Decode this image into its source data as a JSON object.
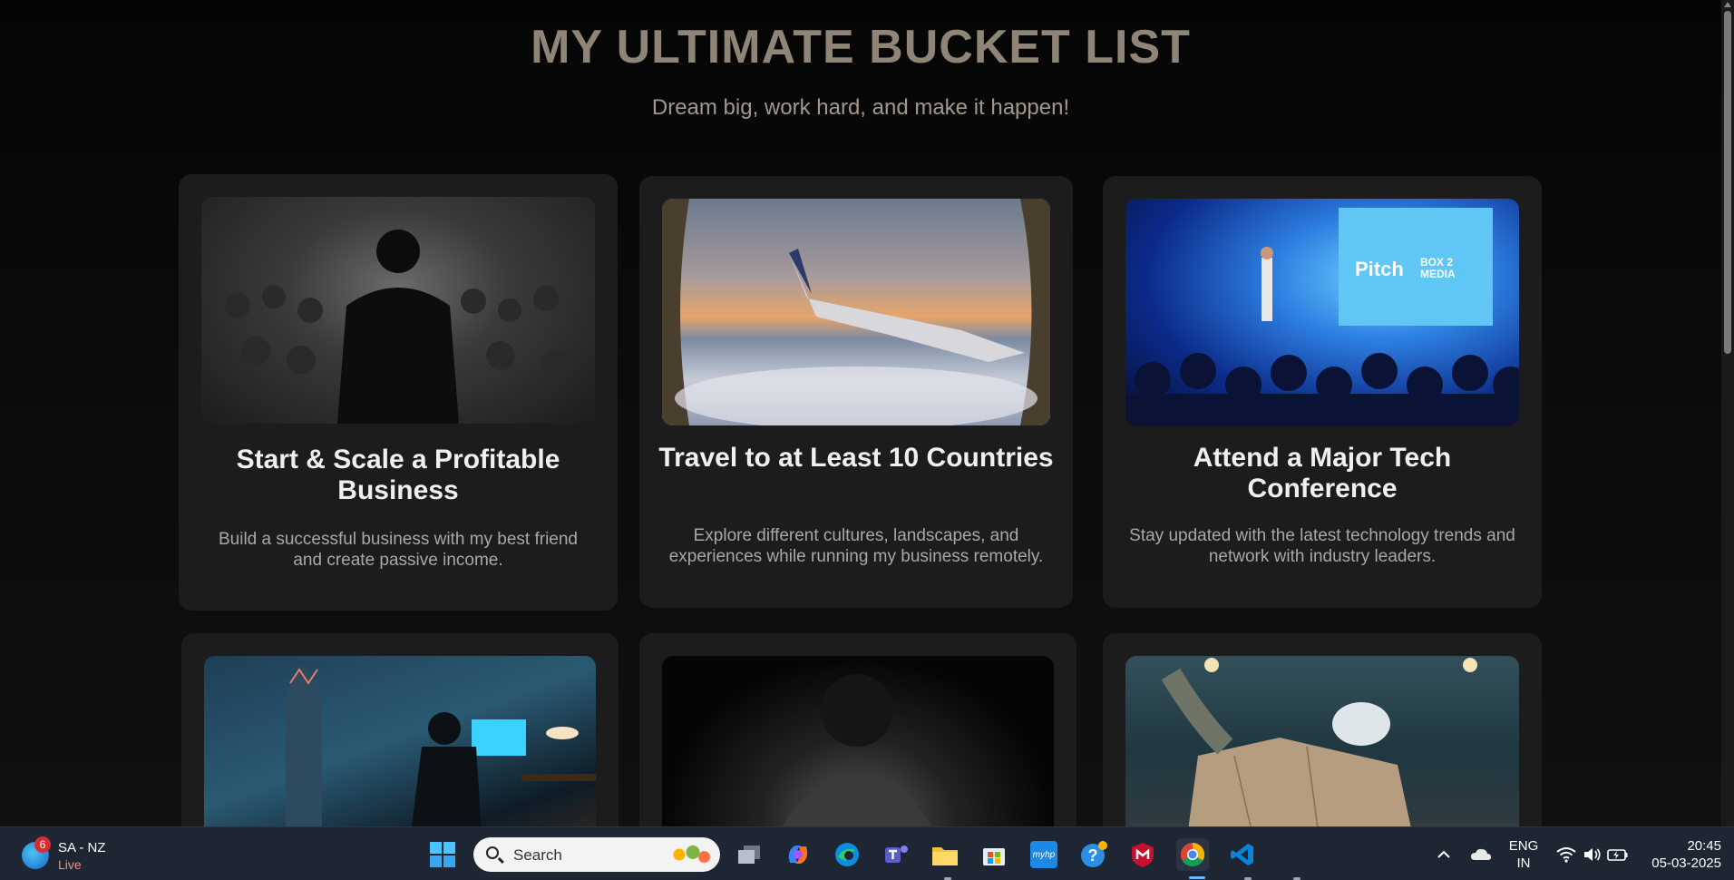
{
  "header": {
    "title": "MY ULTIMATE BUCKET LIST",
    "subtitle": "Dream big, work hard, and make it happen!"
  },
  "cards": [
    {
      "title": "Start & Scale a Profitable Business",
      "desc": "Build a successful business with my best friend and create passive income."
    },
    {
      "title": "Travel to at Least 10 Countries",
      "desc": "Explore different cultures, landscapes, and experiences while running my business remotely."
    },
    {
      "title": "Attend a Major Tech Conference",
      "desc": "Stay updated with the latest technology trends and network with industry leaders."
    },
    {
      "title": "",
      "desc": ""
    },
    {
      "title": "",
      "desc": ""
    },
    {
      "title": "",
      "desc": ""
    }
  ],
  "tech_screen": {
    "brand1": "Pitch",
    "brand2": "BOX 2\nMEDIA"
  },
  "taskbar": {
    "weather": {
      "badge": "6",
      "line1": "SA - NZ",
      "line2": "Live"
    },
    "search": {
      "placeholder": "Search"
    },
    "language": {
      "line1": "ENG",
      "line2": "IN"
    },
    "clock": {
      "time": "20:45",
      "date": "05-03-2025"
    },
    "apps": [
      "start-icon",
      "search-icon",
      "task-view-icon",
      "copilot-icon",
      "edge-icon",
      "teams-icon",
      "file-explorer-icon",
      "store-icon",
      "myhp-icon",
      "help-icon",
      "mcafee-icon",
      "chrome-icon",
      "vscode-icon"
    ],
    "myhp_label": "myhp"
  },
  "colors": {
    "title": "#8f8577",
    "card_bg": "#1c1c1d",
    "taskbar_bg": "#1f2633",
    "accent": "#6cb8ff"
  }
}
